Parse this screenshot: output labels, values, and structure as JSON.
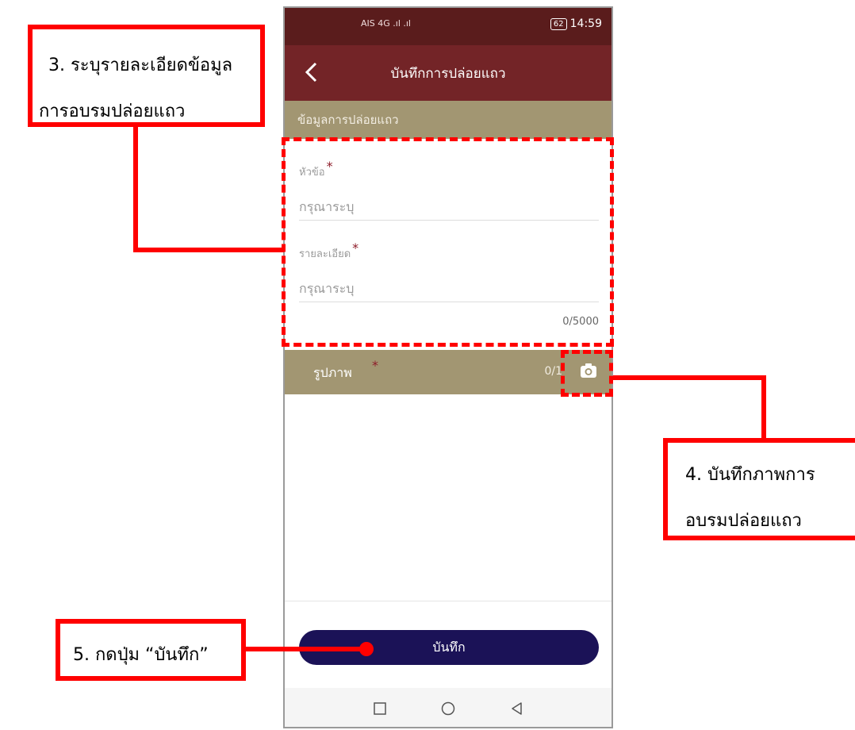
{
  "status_bar": {
    "carrier": "AIS 4G  .ıl .ıl",
    "battery": "62",
    "time": "14:59"
  },
  "app_bar": {
    "title": "บันทึกการปล่อยแถว"
  },
  "section": {
    "title": "ข้อมูลการปล่อยแถว"
  },
  "form": {
    "topic_label": "หัวข้อ",
    "topic_placeholder": "กรุณาระบุ",
    "detail_label": "รายละเอียด",
    "detail_placeholder": "กรุณาระบุ",
    "required_mark": "*",
    "counter": "0/5000"
  },
  "photo": {
    "label": "รูปภาพ",
    "required_mark": "*",
    "count": "0/1"
  },
  "save_button": "บันทึก",
  "annotations": {
    "step3_line1": "3. ระบุรายละเอียดข้อมูล",
    "step3_line2": "การอบรมปล่อยแถว",
    "step4_line1": "4. บันทึกภาพการ",
    "step4_line2": "อบรมปล่อยแถว",
    "step5": "5. กดปุ่ม “บันทึก”"
  },
  "colors": {
    "status_bar": "#5a1c1c",
    "app_bar": "#732427",
    "section_bar": "#a29672",
    "save_button": "#1b1257",
    "annotation": "#ff0000"
  },
  "icons": [
    "back-arrow-icon",
    "camera-icon",
    "nav-recent-icon",
    "nav-home-icon",
    "nav-back-icon"
  ]
}
